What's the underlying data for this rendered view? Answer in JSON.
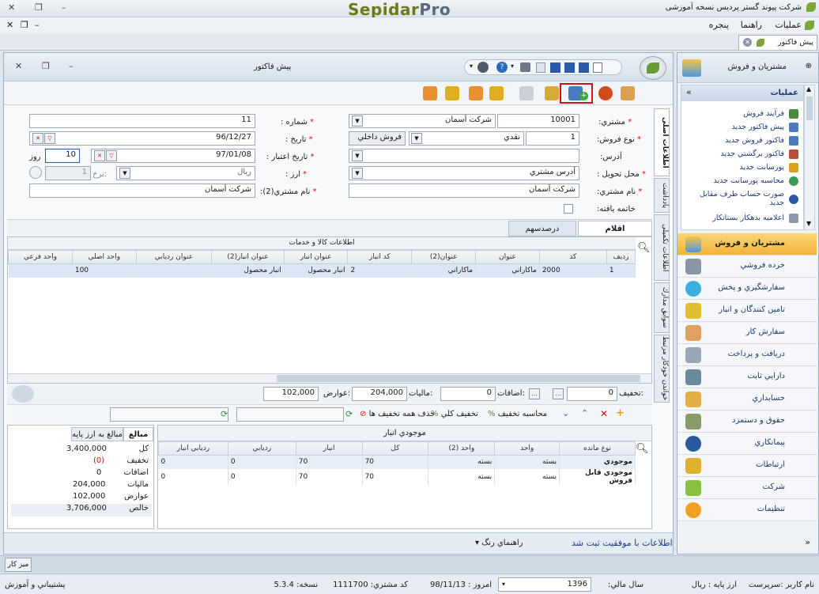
{
  "window": {
    "title": "شرکت پیوند گستر پردیس نسخه آموزشی",
    "logo_main": "Sepidar",
    "logo_sub": "Pro"
  },
  "menu": {
    "items": [
      "عملیات",
      "راهنما",
      "پنجره"
    ]
  },
  "tabs": {
    "active": "پیش فاکتور"
  },
  "doc": {
    "title": "پیش فاکتور",
    "vtabs": [
      "اطلاعات اصلی",
      "یادداشت",
      "اطلاعات تکمیلی",
      "سوابق مدارك",
      "خواندن خودکار مرتبط"
    ],
    "fields": {
      "customer_label": "مشتري:",
      "customer_code": "10001",
      "customer_name": "شرکت آسمان",
      "number_label": "شماره :",
      "number": "11",
      "sale_type_label": "نوع فروش:",
      "sale_type_code": "1",
      "sale_type": "نقدي",
      "sale_kind": "فروش داخلي",
      "date_label": "تاريخ :",
      "date": "96/12/27",
      "address_label": "آدرس:",
      "valid_label": "تاريخ اعتبار :",
      "valid_date": "97/01/08",
      "days": "10",
      "days_unit": "روز",
      "delivery_label": "محل تحويل :",
      "delivery": "آدرس مشتري",
      "currency_label": "ارز :",
      "currency": "ريال",
      "rate_label": "نرخ:",
      "rate": "1",
      "cust_name_label": "نام مشتري:",
      "cust_name": "شرکت آسمان",
      "cust_name2_label": "نام مشتري(2):",
      "cust_name2": "شرکت آسمان",
      "finished_label": "خاتمه يافته:"
    },
    "item_tabs": [
      "اقلام",
      "درصدسهم"
    ],
    "grid": {
      "group_header": "اطلاعات كالا و خدمات",
      "columns": [
        "رديف",
        "كد",
        "عنوان",
        "عنوان(2)",
        "كد انبار",
        "عنوان انبار",
        "عنوان انبار(2)",
        "عنوان رديابي",
        "واحد اصلي",
        "واحد فرعي"
      ],
      "rows": [
        [
          "1",
          "2000",
          "ماكاراني",
          "ماكاراني",
          "2",
          "انبار محصول",
          "انبار محصول",
          "",
          "100",
          ""
        ]
      ]
    },
    "totals": {
      "discount_label": "تخفيف:",
      "discount": "0",
      "additions_label": "اضافات:",
      "additions": "0",
      "tax_label": "ماليات:",
      "tax": "204,000",
      "duties_label": "عوارض:",
      "duties": "102,000"
    },
    "actions": {
      "calc_discount": "محاسبه تخفيف",
      "total_discount": "تخفيف كلي",
      "remove_discounts": "حذف همه تخفيف ها"
    },
    "summary": {
      "tab1": "مبالغ",
      "tab2": "مبالغ به ارز پايه",
      "rows": [
        [
          "كل",
          "3,400,000"
        ],
        [
          "تخفيف",
          "(0)"
        ],
        [
          "اضافات",
          "0"
        ],
        [
          "ماليات",
          "204,000"
        ],
        [
          "عوارض",
          "102,000"
        ],
        [
          "خالص",
          "3,706,000"
        ]
      ]
    },
    "stock": {
      "title": "موجودي انبار",
      "columns": [
        "نوع مانده",
        "واحد",
        "واحد (2)",
        "كل",
        "انبار",
        "رديابي",
        "رديابي انبار"
      ],
      "rows": [
        [
          "موجودي",
          "بسته",
          "بسته",
          "70",
          "70",
          "0",
          "0"
        ],
        [
          "موجودي قابل فروش",
          "بسته",
          "بسته",
          "70",
          "70",
          "0",
          "0"
        ]
      ]
    },
    "status": {
      "message": "اطلاعات با موفقيت ثبت شد",
      "color_guide": "راهنماي رنگ"
    }
  },
  "sidebar": {
    "header": "مشتريان و فروش",
    "ops_title": "عمليات",
    "ops": [
      "فرآيند فروش",
      "پيش فاكتور جديد",
      "فاكتور فروش جديد",
      "فاكتور برگشتي جديد",
      "پورسانت جديد",
      "محاسبه پورسانت جديد",
      "صورت حساب طرف مقابل جديد",
      "اعلاميه بدهكار بستانكار"
    ],
    "modules": [
      "مشتريان و فروش",
      "خرده فروشي",
      "سفارشگيري و پخش",
      "تامين كنندگان و انبار",
      "سفارش كار",
      "دريافت و پرداخت",
      "دارايي ثابت",
      "حسابداري",
      "حقوق و دستمزد",
      "پيمانكاري",
      "ارتباطات",
      "شركت",
      "تنظيمات"
    ]
  },
  "taskbar": {
    "button": "ميز كار"
  },
  "statusbar": {
    "user": "نام کاربر :سرپرست",
    "base_currency": "ارز پايه :   ريال",
    "fiscal_label": "سال مالي:",
    "fiscal_year": "1396",
    "today": "امروز : 98/11/13",
    "customer_code": "كد مشتري: 1111700",
    "version": "نسخه: 5.3.4",
    "support": "پشتيباني و آموزش"
  },
  "colors": {
    "accent": "#d0101a",
    "sidebar_active": "#f6c24a",
    "link": "#1a3a7a"
  }
}
